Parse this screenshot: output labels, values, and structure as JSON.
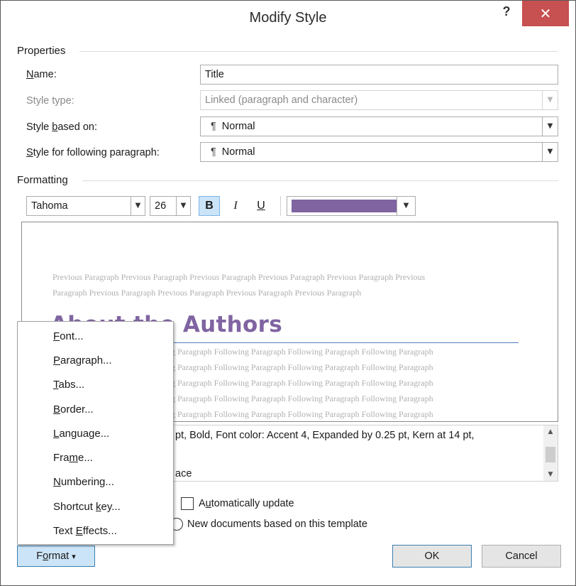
{
  "window": {
    "title": "Modify Style",
    "help_label": "?",
    "close_label": "✕"
  },
  "properties": {
    "section_label": "Properties",
    "name_label_pre": "",
    "name_label_u": "N",
    "name_label_post": "ame:",
    "name_value": "Title",
    "style_type_label": "Style type:",
    "style_type_value": "Linked (paragraph and character)",
    "based_on_label_pre": "Style ",
    "based_on_label_u": "b",
    "based_on_label_post": "ased on:",
    "based_on_value": "Normal",
    "following_label_pre": "",
    "following_label_u": "S",
    "following_label_post": "tyle for following paragraph:",
    "following_value": "Normal",
    "pilcrow": "¶"
  },
  "formatting": {
    "section_label": "Formatting",
    "font_name": "Tahoma",
    "font_size": "26",
    "bold_label": "B",
    "italic_label": "I",
    "underline_label": "U",
    "font_color": "#8064a2"
  },
  "preview": {
    "previous_line1": "Previous Paragraph Previous Paragraph Previous Paragraph Previous Paragraph Previous Paragraph Previous",
    "previous_line2": "Paragraph Previous Paragraph Previous Paragraph Previous Paragraph Previous Paragraph",
    "title_visible": "Authors",
    "title_partial": "About the",
    "following_line": "g Paragraph Following Paragraph Following Paragraph Following Paragraph",
    "following_line_b": "g Paragraph Following Paragraph Following Paragraph Following Paragraph",
    "following_line_c": "g Paragraph Following Paragraph Following Paragraph Following Paragraph",
    "following_line_d": "g Paragraph Following Paragraph Following Paragraph Following Paragraph",
    "following_line_e": "g Paragraph Following Paragraph Following Paragraph Following Paragraph"
  },
  "description": {
    "line1": "pt, Bold, Font color: Accent 4, Expanded by  0.25 pt, Kern at 14 pt,",
    "line3": "ace"
  },
  "options": {
    "auto_update_pre": "A",
    "auto_update_u": "u",
    "auto_update_post": "tomatically update",
    "new_docs_label": "New documents based on this template"
  },
  "buttons": {
    "ok_label": "OK",
    "cancel_label": "Cancel",
    "format_pre": "F",
    "format_u": "o",
    "format_post": "rmat",
    "format_arrow": "▾"
  },
  "format_menu": {
    "items": [
      {
        "pre": "",
        "u": "F",
        "post": "ont..."
      },
      {
        "pre": "",
        "u": "P",
        "post": "aragraph..."
      },
      {
        "pre": "",
        "u": "T",
        "post": "abs..."
      },
      {
        "pre": "",
        "u": "B",
        "post": "order..."
      },
      {
        "pre": "",
        "u": "L",
        "post": "anguage..."
      },
      {
        "pre": "Fra",
        "u": "m",
        "post": "e..."
      },
      {
        "pre": "",
        "u": "N",
        "post": "umbering..."
      },
      {
        "pre": "Shortcut ",
        "u": "k",
        "post": "ey..."
      },
      {
        "pre": "Text ",
        "u": "E",
        "post": "ffects..."
      }
    ]
  },
  "colors": {
    "accent_purple": "#8064a2",
    "title_rule_blue": "#4f81bd",
    "close_red": "#c75050",
    "highlight_blue": "#cce4f7"
  }
}
